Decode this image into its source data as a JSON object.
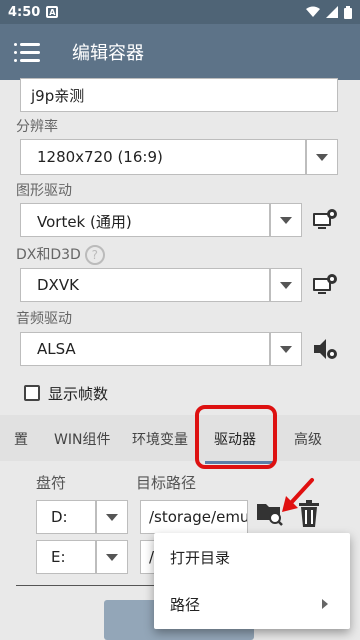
{
  "status_bar": {
    "time": "4:50",
    "notif_letter": "A"
  },
  "app_bar": {
    "title": "编辑容器"
  },
  "name_field": {
    "value": "j9p亲测"
  },
  "resolution": {
    "label": "分辨率",
    "value": "1280x720 (16:9)"
  },
  "graphics_driver": {
    "label": "图形驱动",
    "value": "Vortek (通用)"
  },
  "dx": {
    "label": "DX和D3D",
    "value": "DXVK"
  },
  "audio_driver": {
    "label": "音频驱动",
    "value": "ALSA"
  },
  "show_fps": {
    "label": "显示帧数",
    "checked": false
  },
  "tabs": [
    {
      "label": "置"
    },
    {
      "label": "WIN组件"
    },
    {
      "label": "环境变量"
    },
    {
      "label": "驱动器"
    },
    {
      "label": "高级"
    }
  ],
  "drives": {
    "letter_header": "盘符",
    "path_header": "目标路径",
    "rows": [
      {
        "letter": "D:",
        "path": "/storage/emulated"
      },
      {
        "letter": "E:",
        "path": "/"
      }
    ]
  },
  "popup_menu": {
    "items": [
      {
        "label": "打开目录"
      },
      {
        "label": "路径"
      }
    ]
  },
  "colors": {
    "app_bar": "#5d7388",
    "status_bar": "#4f6476",
    "highlight": "#dd1111"
  }
}
